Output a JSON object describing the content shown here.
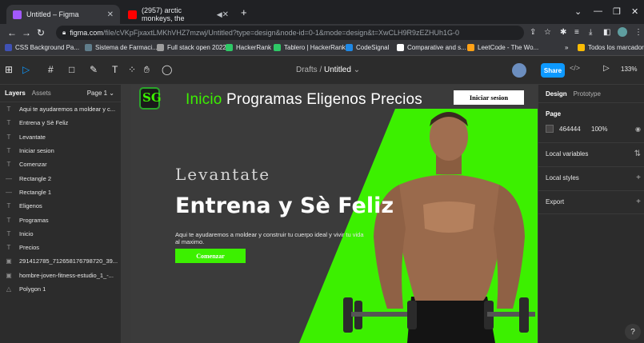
{
  "browser": {
    "tabs": [
      {
        "title": "Untitled – Figma",
        "favicon_color": "#a259ff",
        "active": true
      },
      {
        "title": "(2957) arctic monkeys, the",
        "favicon_color": "#ff0000",
        "active": false
      }
    ],
    "new_tab": "+",
    "address_host": "figma.com",
    "address_path": "/file/cVKpFjxaxtLMKhVHZ7mzwj/Untitled?type=design&node-id=0-1&mode=design&t=XwCLH9R9zEZHUh1G-0",
    "bookmarks": [
      {
        "label": "CSS Background Pa...",
        "color": "#3f51b5"
      },
      {
        "label": "Sistema de Farmaci...",
        "color": "#607d8b"
      },
      {
        "label": "Full stack open 2022",
        "color": "#9e9e9e"
      },
      {
        "label": "HackerRank",
        "color": "#2ec866"
      },
      {
        "label": "Tablero | HackerRank",
        "color": "#2ec866"
      },
      {
        "label": "CodeSignal",
        "color": "#1e88e5"
      },
      {
        "label": "Comparative and s...",
        "color": "#ffffff"
      },
      {
        "label": "LeetCode - The Wo...",
        "color": "#ffa116"
      }
    ],
    "bookmarks_folder": "Todos los marcadores"
  },
  "figma": {
    "drafts": "Drafts",
    "file_name": "Untitled",
    "share_label": "Share",
    "zoom": "133%",
    "left_panel": {
      "tab_layers": "Layers",
      "tab_assets": "Assets",
      "page": "Page 1",
      "layers": [
        {
          "icon": "T",
          "name": "Aqui te ayudaremos a moldear y c..."
        },
        {
          "icon": "T",
          "name": "Entrena y Sè Feliz"
        },
        {
          "icon": "T",
          "name": "Levantate"
        },
        {
          "icon": "T",
          "name": "Iniciar sesion"
        },
        {
          "icon": "T",
          "name": "Comenzar"
        },
        {
          "icon": "—",
          "name": "Rectangle 2"
        },
        {
          "icon": "—",
          "name": "Rectangle 1"
        },
        {
          "icon": "T",
          "name": "Eligenos"
        },
        {
          "icon": "T",
          "name": "Programas"
        },
        {
          "icon": "T",
          "name": "Inicio"
        },
        {
          "icon": "T",
          "name": "Precios"
        },
        {
          "icon": "▣",
          "name": "291412785_712658176798720_39..."
        },
        {
          "icon": "▣",
          "name": "hombre-joven-fitness-estudio_1_-..."
        },
        {
          "icon": "△",
          "name": "Polygon 1"
        }
      ]
    },
    "right_panel": {
      "tab_design": "Design",
      "tab_prototype": "Prototype",
      "page_title": "Page",
      "page_color": "464444",
      "page_opacity": "100%",
      "local_variables": "Local variables",
      "local_styles": "Local styles",
      "export": "Export"
    }
  },
  "design": {
    "logo_text": "SG",
    "nav_inicio": "Inicio",
    "nav_rest": " Programas Eligenos Precios",
    "login_button": "Iniciar sesion",
    "levantate": "Levantate",
    "headline": "Entrena y Sè Feliz",
    "subtext": "Aqui te ayudaremos a moldear y construir tu cuerpo ideal y vivir tu vida al maximo.",
    "cta_button": "Comenzar",
    "accent_color": "#3cf000",
    "frame_bg": "#3b3b3b"
  },
  "help": "?"
}
